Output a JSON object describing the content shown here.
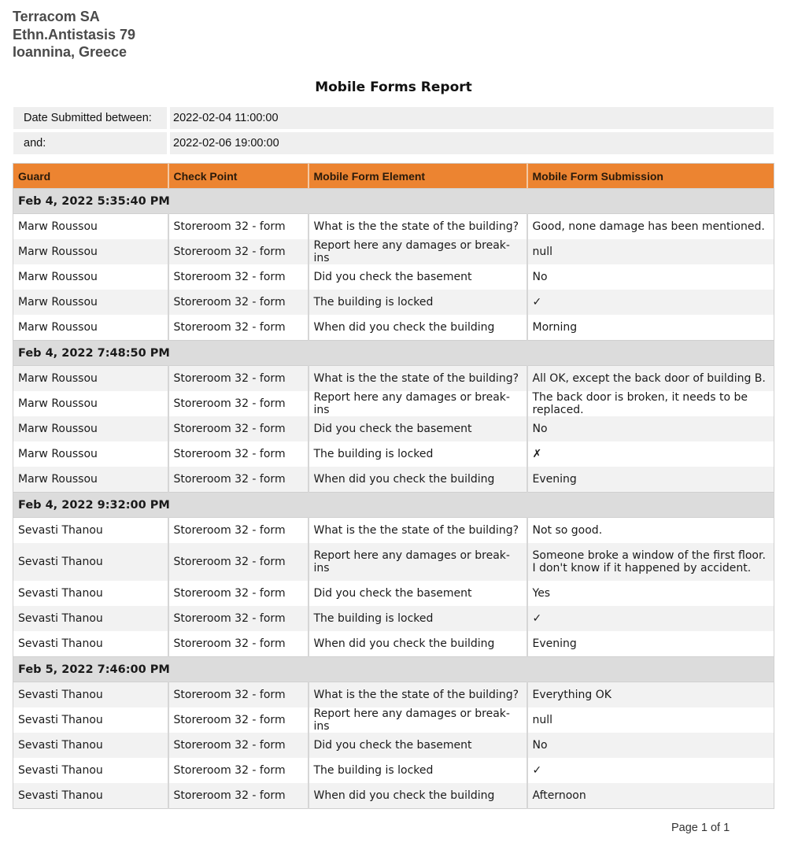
{
  "company": {
    "name": "Terracom SA",
    "address": "Ethn.Antistasis 79",
    "city": "Ioannina, Greece"
  },
  "report_title": "Mobile Forms Report",
  "criteria": [
    {
      "label": "Date Submitted between:",
      "value": "2022-02-04  11:00:00"
    },
    {
      "label": "and:",
      "value": "2022-02-06  19:00:00"
    }
  ],
  "colors": {
    "header_bg": "#ec8431",
    "group_bg": "#dcdcdc",
    "alt_row_bg": "#f2f2f2"
  },
  "table": {
    "headers": [
      "Guard",
      "Check Point",
      "Mobile Form Element",
      "Mobile Form Submission"
    ],
    "groups": [
      {
        "timestamp": "Feb 4, 2022 5:35:40 PM",
        "rows": [
          {
            "guard": "Marw Roussou",
            "checkpoint": "Storeroom 32 -  form",
            "element": "What is the the state of the building?",
            "submission": "Good, none damage has been mentioned."
          },
          {
            "guard": "Marw Roussou",
            "checkpoint": "Storeroom 32 -  form",
            "element": "Report here any damages or break-ins",
            "submission": "null"
          },
          {
            "guard": "Marw Roussou",
            "checkpoint": "Storeroom 32 -  form",
            "element": "Did you check the basement",
            "submission": "No"
          },
          {
            "guard": "Marw Roussou",
            "checkpoint": "Storeroom 32 -  form",
            "element": "The building is locked",
            "submission": "✓"
          },
          {
            "guard": "Marw Roussou",
            "checkpoint": "Storeroom 32 -  form",
            "element": "When did you check the building",
            "submission": "Morning"
          }
        ]
      },
      {
        "timestamp": "Feb 4, 2022 7:48:50 PM",
        "rows": [
          {
            "guard": "Marw Roussou",
            "checkpoint": "Storeroom 32 -  form",
            "element": "What is the the state of the building?",
            "submission": "All OK, except the back door of building B."
          },
          {
            "guard": "Marw Roussou",
            "checkpoint": "Storeroom 32 -  form",
            "element": "Report here any damages or break-ins",
            "submission": "The back door is broken, it needs to be replaced."
          },
          {
            "guard": "Marw Roussou",
            "checkpoint": "Storeroom 32 -  form",
            "element": "Did you check the basement",
            "submission": "No"
          },
          {
            "guard": "Marw Roussou",
            "checkpoint": "Storeroom 32 -  form",
            "element": "The building is locked",
            "submission": "✗"
          },
          {
            "guard": "Marw Roussou",
            "checkpoint": "Storeroom 32 -  form",
            "element": "When did you check the building",
            "submission": "Evening"
          }
        ]
      },
      {
        "timestamp": "Feb 4, 2022 9:32:00 PM",
        "rows": [
          {
            "guard": "Sevasti Thanou",
            "checkpoint": "Storeroom 32 -  form",
            "element": "What is the the state of the building?",
            "submission": "Not so good."
          },
          {
            "guard": "Sevasti Thanou",
            "checkpoint": "Storeroom 32 -  form",
            "element": "Report here any damages or break-ins",
            "submission": "Someone broke a window of the first floor. I don't know if it happened by accident."
          },
          {
            "guard": "Sevasti Thanou",
            "checkpoint": "Storeroom 32 -  form",
            "element": "Did you check the basement",
            "submission": "Yes"
          },
          {
            "guard": "Sevasti Thanou",
            "checkpoint": "Storeroom 32 -  form",
            "element": "The building is locked",
            "submission": "✓"
          },
          {
            "guard": "Sevasti Thanou",
            "checkpoint": "Storeroom 32 -  form",
            "element": "When did you check the building",
            "submission": "Evening"
          }
        ]
      },
      {
        "timestamp": "Feb 5, 2022 7:46:00 PM",
        "rows": [
          {
            "guard": "Sevasti Thanou",
            "checkpoint": "Storeroom 32 -  form",
            "element": "What is the the state of the building?",
            "submission": "Everything OK"
          },
          {
            "guard": "Sevasti Thanou",
            "checkpoint": "Storeroom 32 -  form",
            "element": "Report here any damages or break-ins",
            "submission": "null"
          },
          {
            "guard": "Sevasti Thanou",
            "checkpoint": "Storeroom 32 -  form",
            "element": "Did you check the basement",
            "submission": "No"
          },
          {
            "guard": "Sevasti Thanou",
            "checkpoint": "Storeroom 32 -  form",
            "element": "The building is locked",
            "submission": "✓"
          },
          {
            "guard": "Sevasti Thanou",
            "checkpoint": "Storeroom 32 -  form",
            "element": "When did you check the building",
            "submission": "Afternoon"
          }
        ]
      }
    ]
  },
  "footer": {
    "page_label": "Page 1 of 1"
  }
}
